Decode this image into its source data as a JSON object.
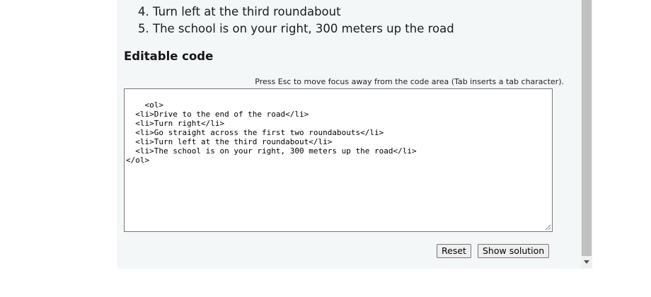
{
  "list": {
    "items": [
      {
        "num": "4.",
        "text": "Turn left at the third roundabout"
      },
      {
        "num": "5.",
        "text": "The school is on your right, 300 meters up the road"
      }
    ]
  },
  "editor": {
    "heading": "Editable code",
    "hint": "Press Esc to move focus away from the code area (Tab inserts a tab character).",
    "code": "<ol>\n  <li>Drive to the end of the road</li>\n  <li>Turn right</li>\n  <li>Go straight across the first two roundabouts</li>\n  <li>Turn left at the third roundabout</li>\n  <li>The school is on your right, 300 meters up the road</li>\n</ol>"
  },
  "buttons": {
    "reset": "Reset",
    "show_solution": "Show solution"
  }
}
